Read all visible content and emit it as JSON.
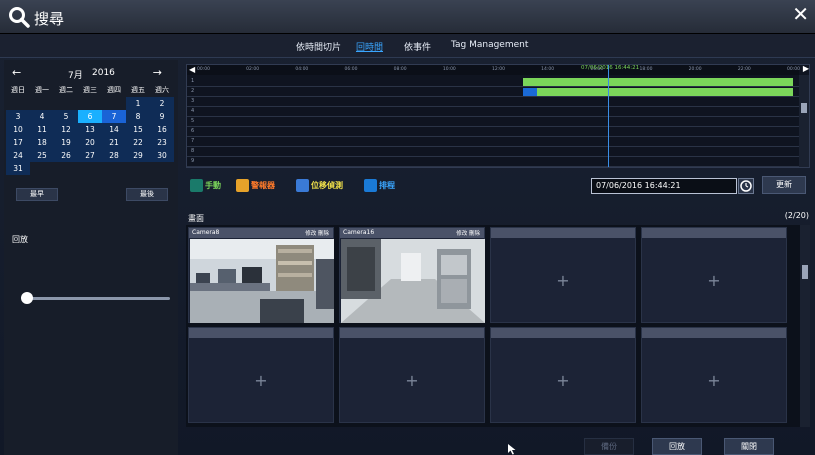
{
  "window": {
    "title": "搜尋",
    "close_label": "✕"
  },
  "tabs": [
    {
      "label": "依時間切片",
      "active": false
    },
    {
      "label": "回時間",
      "active": true
    },
    {
      "label": "依事件",
      "active": false
    },
    {
      "label": "Tag Management",
      "active": false
    }
  ],
  "calendar": {
    "month": "7月",
    "year": "2016",
    "weekdays": [
      "週日",
      "週一",
      "週二",
      "週三",
      "週四",
      "週五",
      "週六"
    ],
    "weeks": [
      [
        "",
        "",
        "",
        "",
        "",
        "1",
        "2"
      ],
      [
        "3",
        "4",
        "5",
        "6",
        "7",
        "8",
        "9"
      ],
      [
        "10",
        "11",
        "12",
        "13",
        "14",
        "15",
        "16"
      ],
      [
        "17",
        "18",
        "19",
        "20",
        "21",
        "22",
        "23"
      ],
      [
        "24",
        "25",
        "26",
        "27",
        "28",
        "29",
        "30"
      ],
      [
        "31",
        "",
        "",
        "",
        "",
        "",
        ""
      ]
    ],
    "selected_day": "6",
    "highlight_day": "7",
    "earliest_label": "最早",
    "latest_label": "最後"
  },
  "left_panel": {
    "playback_label": "回放"
  },
  "timeline": {
    "ticks": [
      "00:00",
      "02:00",
      "04:00",
      "06:00",
      "08:00",
      "10:00",
      "12:00",
      "14:00",
      "16:00",
      "18:00",
      "20:00",
      "22:00",
      "00:00"
    ],
    "rows": [
      "1",
      "2",
      "3",
      "4",
      "5",
      "6",
      "7",
      "8",
      "9"
    ],
    "cursor_time": "07/06/2016 16:44:21",
    "colors": {
      "record": "#7bd65a",
      "cursor": "#3a8ee6"
    }
  },
  "event_types": [
    {
      "label": "手動",
      "icon": "manual-record-icon",
      "color": "#7bd65a",
      "icon_bg": "#1a7a6a"
    },
    {
      "label": "警報器",
      "icon": "alarm-icon",
      "color": "#ff7a2a",
      "icon_bg": "#e6a22a"
    },
    {
      "label": "位移偵測",
      "icon": "motion-detect-icon",
      "color": "#f0e04a",
      "icon_bg": "#3a7ad6"
    },
    {
      "label": "排程",
      "icon": "schedule-icon",
      "color": "#3aa6ff",
      "icon_bg": "#1a7ad6"
    }
  ],
  "time_field": {
    "value": "07/06/2016 16:44:21"
  },
  "refresh_label": "更新",
  "grid": {
    "label": "畫面",
    "page": "(2/20)",
    "tiles": [
      {
        "camera": "Camera8",
        "actions": "修改 刪除",
        "has_video": true
      },
      {
        "camera": "Camera16",
        "actions": "修改 刪除",
        "has_video": true
      },
      {
        "camera": "",
        "actions": "",
        "has_video": false
      },
      {
        "camera": "",
        "actions": "",
        "has_video": false
      },
      {
        "camera": "",
        "actions": "",
        "has_video": false
      },
      {
        "camera": "",
        "actions": "",
        "has_video": false
      },
      {
        "camera": "",
        "actions": "",
        "has_video": false
      },
      {
        "camera": "",
        "actions": "",
        "has_video": false
      }
    ],
    "plus": "+"
  },
  "bottom": {
    "backup_label": "備份",
    "playback_label": "回放",
    "close_label": "關閉"
  }
}
